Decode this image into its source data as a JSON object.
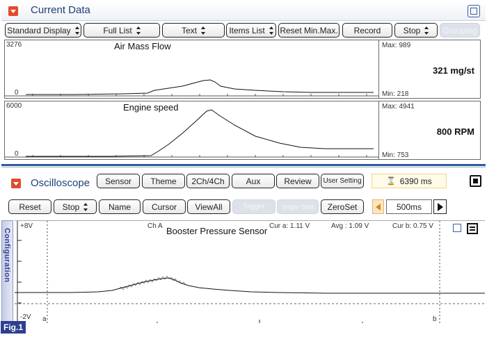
{
  "current_data": {
    "title": "Current Data",
    "toolbar": {
      "display_mode": "Standard Display",
      "list_filter": "Full List",
      "view_mode": "Text",
      "items_list": "Items List",
      "reset_minmax": "Reset Min.Max.",
      "record": "Record",
      "stop": "Stop",
      "grouping": "Grouping"
    },
    "graphs": [
      {
        "title": "Air Mass Flow",
        "y_top": "3276",
        "y_bottom": "0",
        "max_label": "Max: 989",
        "min_label": "Min:  218",
        "current_value": "321 mg/st"
      },
      {
        "title": "Engine speed",
        "y_top": "6000",
        "y_bottom": "0",
        "max_label": "Max: 4941",
        "min_label": "Min:  753",
        "current_value": "800 RPM"
      }
    ]
  },
  "oscilloscope": {
    "title": "Oscilloscope",
    "tab_buttons": [
      "Sensor",
      "Theme",
      "2Ch/4Ch",
      "Aux",
      "Review",
      "User Setting"
    ],
    "time_display": "6390 ms",
    "toolbar": {
      "reset": "Reset",
      "stop": "Stop",
      "name": "Name",
      "cursor": "Cursor",
      "viewall": "ViewAll",
      "trigger": "Trigger",
      "single_shot": "Single Shot",
      "zeroset": "ZeroSet",
      "timebase": "500ms"
    },
    "scope": {
      "y_top": "+8V",
      "y_bottom": "-2V",
      "channel": "Ch A",
      "signal_name": "Booster Pressure Sensor",
      "cur_a": "Cur a: 1.11 V",
      "avg": "Avg  : 1.09 V",
      "cur_b": "Cur b: 0.75 V",
      "marker_a": "a",
      "marker_b": "b"
    },
    "config_tab": "Configuration"
  },
  "figure_tag": "Fig.1",
  "colors": {
    "header_title": "#1d3f78",
    "collapse": "#e24a2a",
    "accent_blue": "#2f5aa0",
    "fig_bg": "#2e3f8f"
  }
}
